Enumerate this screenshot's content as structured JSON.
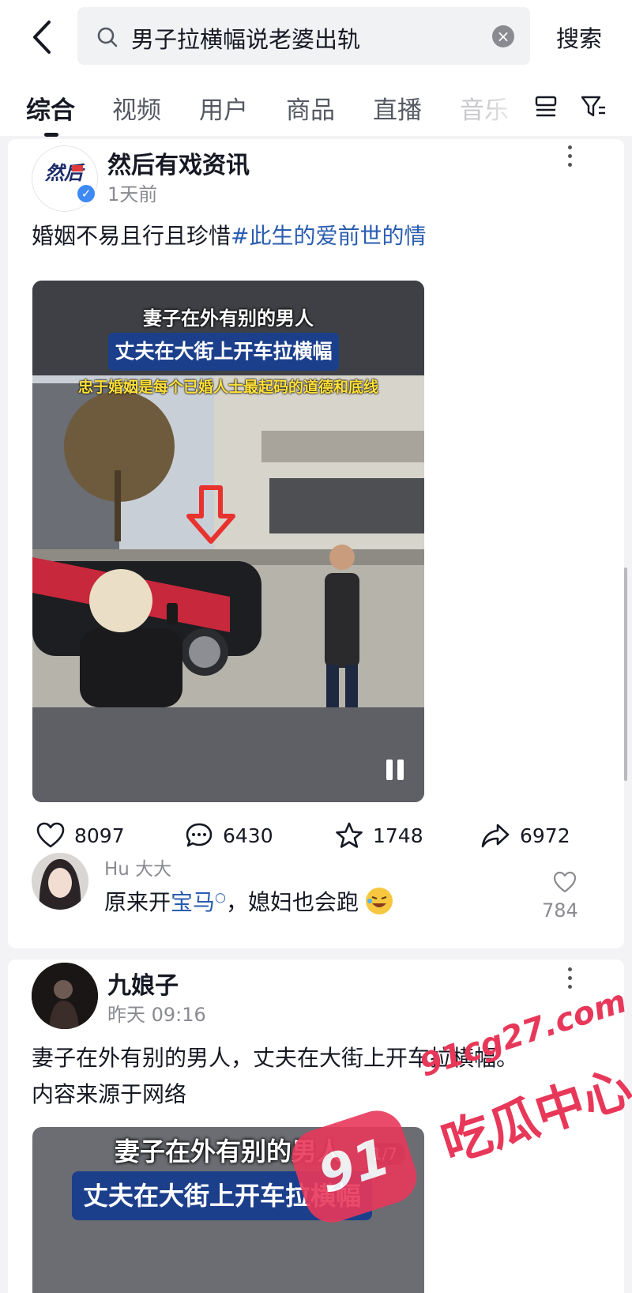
{
  "search": {
    "query": "男子拉横幅说老婆出轨",
    "button_label": "搜索"
  },
  "tabs": [
    {
      "label": "综合",
      "active": true
    },
    {
      "label": "视频"
    },
    {
      "label": "用户"
    },
    {
      "label": "商品"
    },
    {
      "label": "直播"
    },
    {
      "label": "音乐"
    }
  ],
  "posts": [
    {
      "author": "然后有戏资讯",
      "avatar_text": "然后",
      "time": "1天前",
      "caption": "婚姻不易且行且珍惜",
      "hashtag": "#此生的爱前世的情",
      "overlay": {
        "line1": "妻子在外有别的男人",
        "line2": "丈夫在大街上开车拉横幅",
        "line3": "忠于婚姻是每个已婚人士最起码的道德和底线"
      },
      "stats": {
        "likes": "8097",
        "comments": "6430",
        "favorites": "1748",
        "shares": "6972"
      },
      "top_comment": {
        "user": "Hu 大大",
        "text_before": "原来开",
        "keyword": "宝马",
        "text_after": "，媳妇也会跑",
        "likes": "784"
      }
    },
    {
      "author": "九娘子",
      "time": "昨天 09:16",
      "caption_line1": "妻子在外有别的男人，丈夫在大街上开车拉横幅。",
      "caption_line2": "内容来源于网络",
      "overlay": {
        "line1": "妻子在外有别的男人",
        "line2": "丈夫在大街上开车拉横幅",
        "counter": "1/7"
      }
    }
  ],
  "watermark": {
    "url": "91cg27.com",
    "main": "吃瓜中心",
    "logo": "91"
  },
  "colors": {
    "accent_link": "#2a5db0",
    "verified": "#3d8af7",
    "watermark": "#e8385a"
  }
}
